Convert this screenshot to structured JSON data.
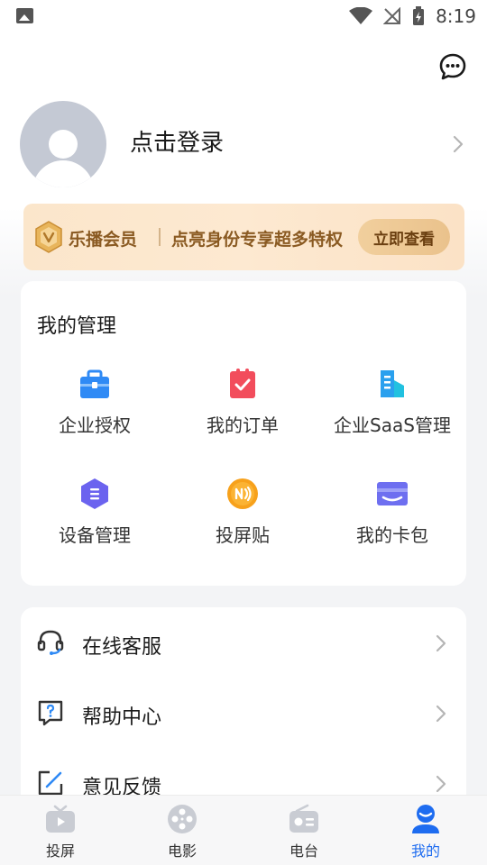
{
  "status_bar": {
    "time": "8:19",
    "icons": [
      "image-notification-icon",
      "wifi-icon",
      "no-signal-icon",
      "battery-charging-icon"
    ]
  },
  "header": {
    "message_icon": "chat-bubble-icon"
  },
  "profile": {
    "login_text": "点击登录"
  },
  "vip_banner": {
    "title": "乐播会员",
    "description": "点亮身份专享超多特权",
    "button": "立即查看",
    "colors": {
      "background": "#fde9d1",
      "text": "#8a5a22",
      "button": "#eac28c"
    }
  },
  "management": {
    "title": "我的管理",
    "items": [
      {
        "label": "企业授权",
        "icon": "briefcase-icon",
        "color": "#2f8af5"
      },
      {
        "label": "我的订单",
        "icon": "clipboard-check-icon",
        "color": "#f24d5c"
      },
      {
        "label": "企业SaaS管理",
        "icon": "building-icon",
        "color": "#2aa0ee"
      },
      {
        "label": "设备管理",
        "icon": "hexagon-device-icon",
        "color": "#6b63ef"
      },
      {
        "label": "投屏贴",
        "icon": "nfc-sticker-icon",
        "color": "#f7a11b"
      },
      {
        "label": "我的卡包",
        "icon": "card-wallet-icon",
        "color": "#6e6ff0"
      }
    ]
  },
  "services": {
    "items": [
      {
        "label": "在线客服",
        "icon": "headset-icon"
      },
      {
        "label": "帮助中心",
        "icon": "help-question-icon"
      },
      {
        "label": "意见反馈",
        "icon": "edit-feedback-icon"
      }
    ]
  },
  "bottom_nav": {
    "items": [
      {
        "label": "投屏",
        "icon": "tv-icon",
        "active": false
      },
      {
        "label": "电影",
        "icon": "film-reel-icon",
        "active": false
      },
      {
        "label": "电台",
        "icon": "radio-icon",
        "active": false
      },
      {
        "label": "我的",
        "icon": "user-profile-icon",
        "active": true
      }
    ],
    "active_color": "#1e6cf0",
    "inactive_icon_color": "#c9ccd3"
  }
}
